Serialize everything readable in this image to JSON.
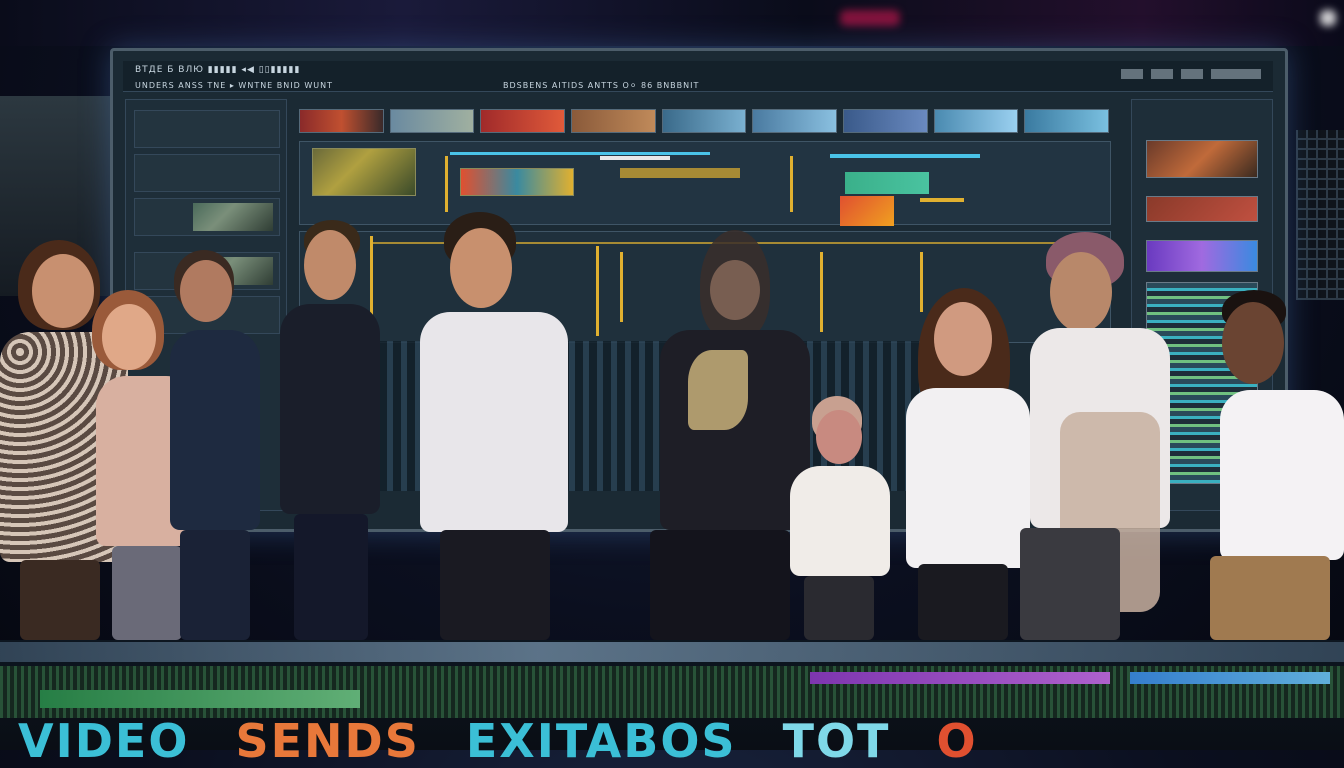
{
  "monitor": {
    "topbar_left": "ВТДЕ Б ВЛЮ ▮▮▮▮▮   ◂◀ ▯▯▮▮▮▮▮",
    "topbar_sub": "UNDERS ANSS TNE ▸ WNTNE      BNID  WUNT",
    "topbar_mid": "BDSBENS AITIDS ANTTS O⚪   86 BNBBNIT",
    "topbar_right": "▭▭▭ ▭▭▭ ▭▭▭▭▭▭▭▭",
    "accent_colors": [
      "#4ac3e8",
      "#e0b030",
      "#e8e8e8",
      "#e05030"
    ]
  },
  "headline": {
    "word1": "VIDEO",
    "word2": "SENDS",
    "word3": "EXITABOS",
    "word4": "TOT",
    "word5": "O"
  },
  "colors": {
    "word1": "#3bbfd6",
    "word2": "#e8783a",
    "word3": "#3bbfd6",
    "word4": "#7fd8e8",
    "word5": "#e05030"
  }
}
